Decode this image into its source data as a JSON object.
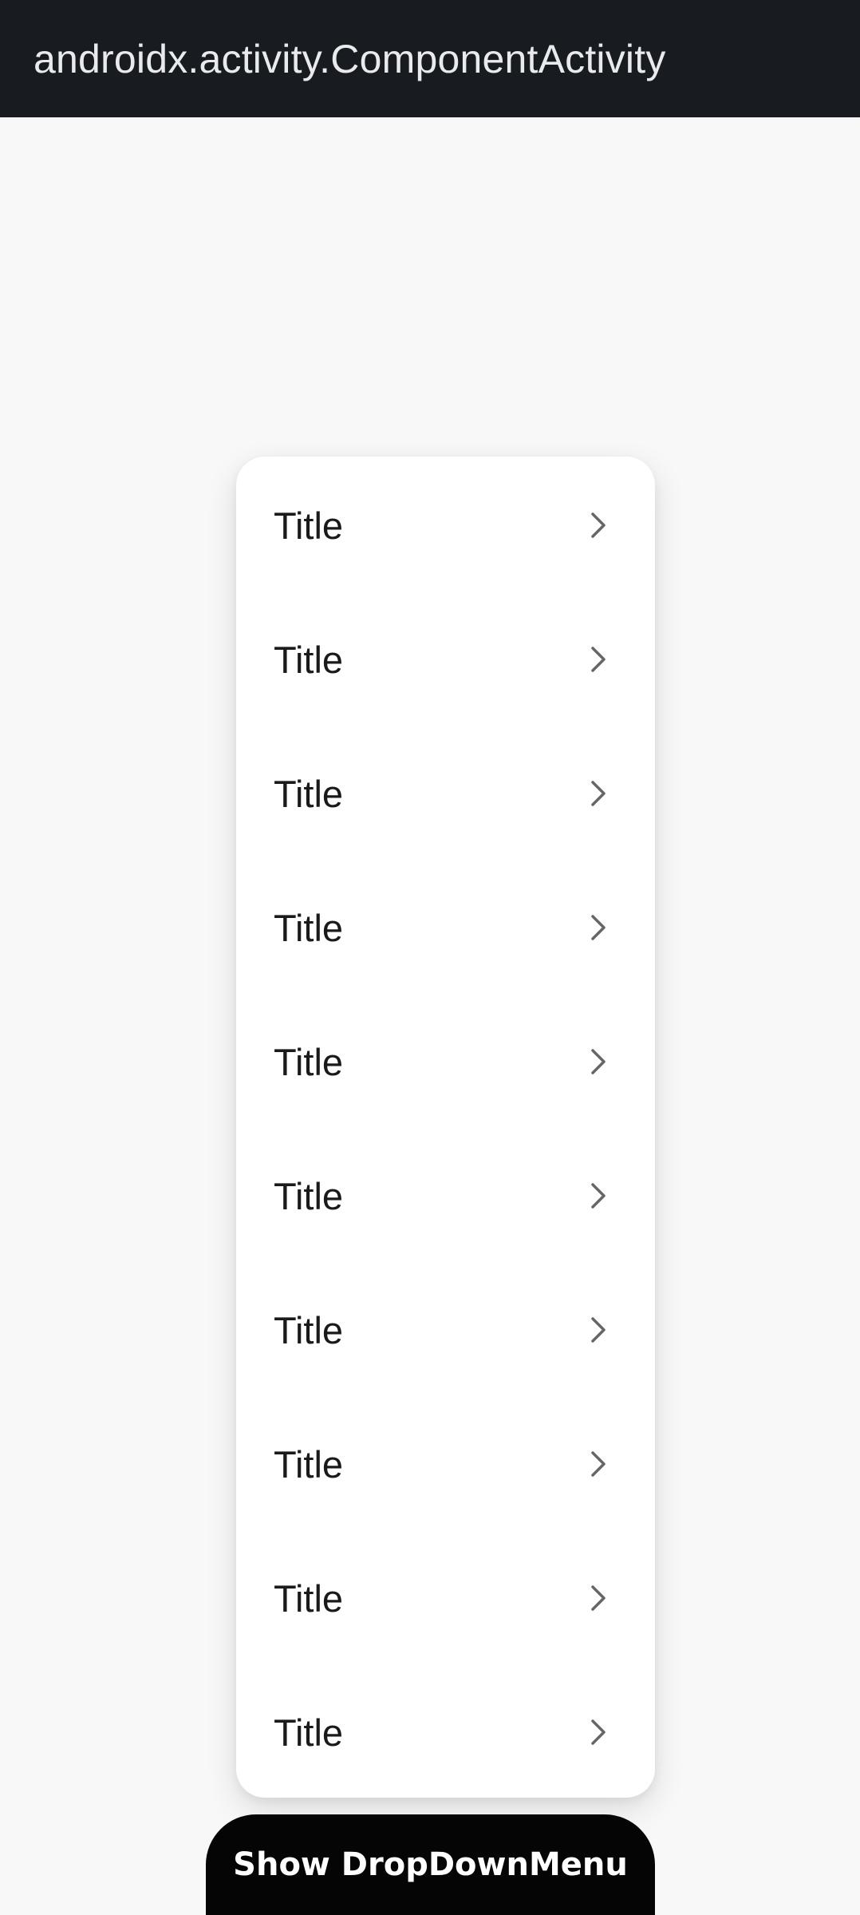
{
  "app_bar": {
    "title": "androidx.activity.ComponentActivity"
  },
  "dropdown_menu": {
    "items": [
      {
        "label": "Title",
        "icon": "chevron-right-icon"
      },
      {
        "label": "Title",
        "icon": "chevron-right-icon"
      },
      {
        "label": "Title",
        "icon": "chevron-right-icon"
      },
      {
        "label": "Title",
        "icon": "chevron-right-icon"
      },
      {
        "label": "Title",
        "icon": "chevron-right-icon"
      },
      {
        "label": "Title",
        "icon": "chevron-right-icon"
      },
      {
        "label": "Title",
        "icon": "chevron-right-icon"
      },
      {
        "label": "Title",
        "icon": "chevron-right-icon"
      },
      {
        "label": "Title",
        "icon": "chevron-right-icon"
      },
      {
        "label": "Title",
        "icon": "chevron-right-icon"
      }
    ]
  },
  "show_button": {
    "label": "Show DropDownMenu"
  },
  "colors": {
    "app_bar_bg": "#181b1f",
    "page_bg": "#f8f8f8",
    "menu_bg": "#ffffff",
    "button_bg": "#050505",
    "chevron": "#666666"
  }
}
